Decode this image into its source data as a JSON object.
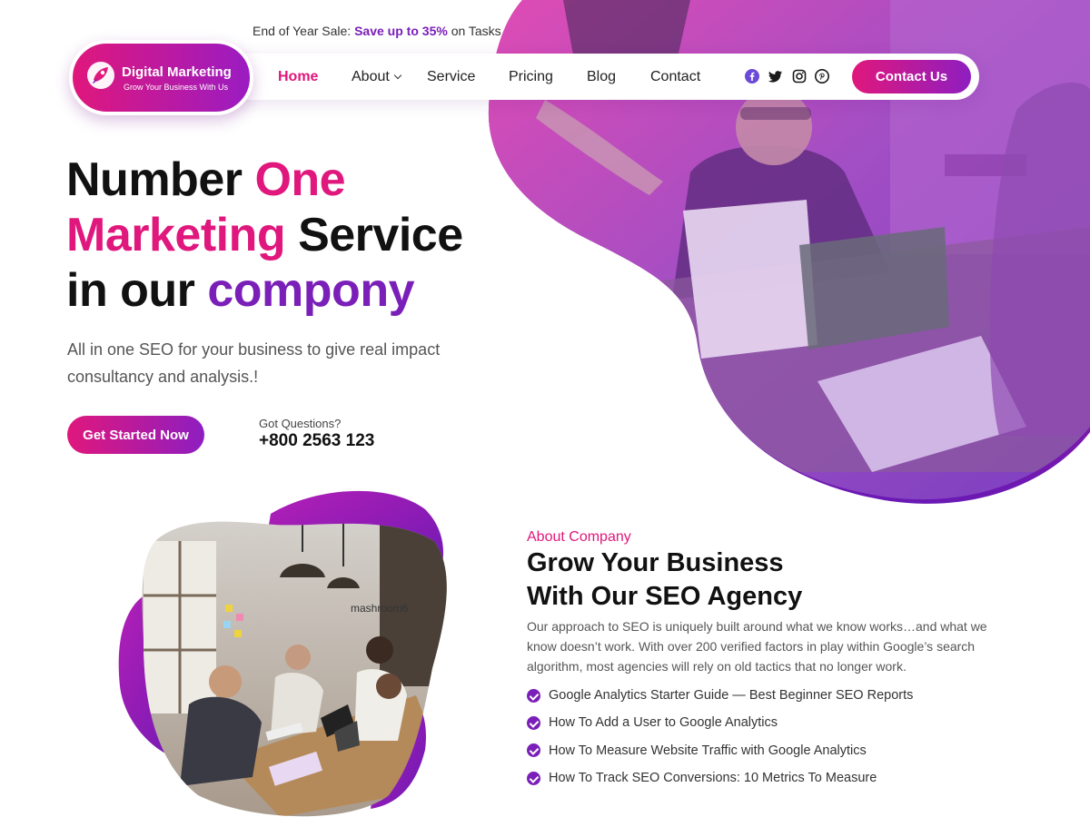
{
  "topbar": {
    "sale_prefix": "End of Year Sale:",
    "sale_highlight": "Save up to 35%",
    "sale_suffix": "on Tasks"
  },
  "logo": {
    "title": "Digital Marketing",
    "tagline": "Grow Your Business With Us"
  },
  "nav": {
    "items": [
      {
        "label": "Home",
        "active": true
      },
      {
        "label": "About",
        "has_dropdown": true
      },
      {
        "label": "Service"
      },
      {
        "label": "Pricing"
      },
      {
        "label": "Blog"
      },
      {
        "label": "Contact"
      }
    ],
    "social_icons": [
      "facebook-icon",
      "twitter-icon",
      "instagram-icon",
      "pinterest-icon"
    ],
    "contact_button": "Contact Us"
  },
  "hero": {
    "title_parts": [
      "Number",
      "One",
      "Marketing",
      "Service",
      "in our",
      "compony"
    ],
    "subtitle": "All in one SEO for your business to give real impact consultancy and analysis.!",
    "cta": "Get Started Now",
    "questions_label": "Got Questions?",
    "phone": "+800 2563 123"
  },
  "about": {
    "tag": "About Company",
    "title_line1": "Grow Your Business",
    "title_line2": "With Our SEO Agency",
    "description": "Our approach to SEO is uniquely built around what we know works…and what we know doesn’t work. With over 200 verified factors in play within Google’s search algorithm, most agencies will rely on old tactics that no longer work.",
    "features": [
      "Google Analytics Starter Guide — Best Beginner SEO Reports",
      "How To Add a User to Google Analytics",
      "How To Measure Website Traffic with Google Analytics",
      "How To Track SEO Conversions: 10 Metrics To Measure"
    ],
    "photo_sign_text": "mashroom6"
  },
  "colors": {
    "accent_pink": "#e0177c",
    "accent_purple": "#7a1fb8",
    "text_dark": "#111111",
    "text_muted": "#555555"
  }
}
